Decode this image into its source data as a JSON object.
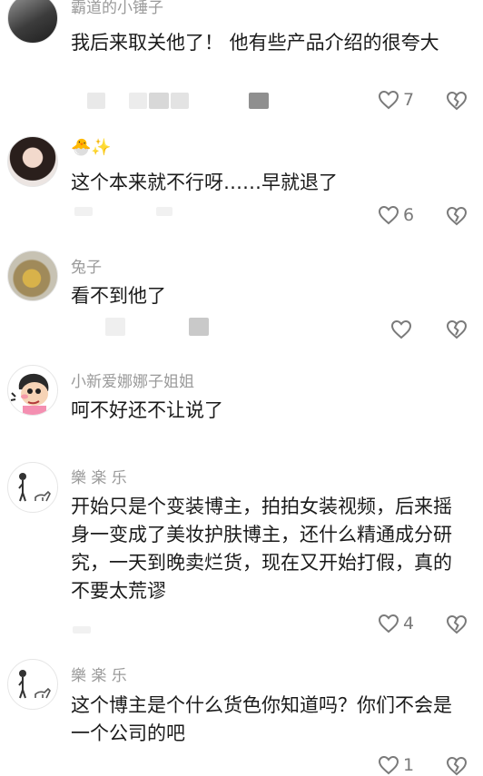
{
  "comments": [
    {
      "username": "霸道的小锤子",
      "text": "我后来取关他了！ 他有些产品介绍的很夸大",
      "likes": "7"
    },
    {
      "username_emoji": "🐣✨",
      "text": "这个本来就不行呀……早就退了",
      "likes": "6"
    },
    {
      "username": "兔子",
      "text": "看不到他了",
      "likes": ""
    },
    {
      "username": "小新爱娜娜子姐姐",
      "text": "呵不好还不让说了",
      "likes": ""
    },
    {
      "username": "樂 楽 乐",
      "text": "开始只是个变装博主，拍拍女装视频，后来摇身一变成了美妆护肤博主，还什么精通成分研究，一天到晚卖烂货，现在又开始打假，真的不要太荒谬",
      "likes": "4"
    },
    {
      "username": "樂 楽 乐",
      "text": "这个博主是个什么货色你知道吗？你们不会是一个公司的吧",
      "likes": "1"
    }
  ],
  "icons": {
    "like": "heart-outline-icon",
    "dislike": "broken-heart-outline-icon"
  },
  "colors": {
    "username": "#9a9a9a",
    "text": "#1b1b1b",
    "icon": "#7a7a7a"
  }
}
